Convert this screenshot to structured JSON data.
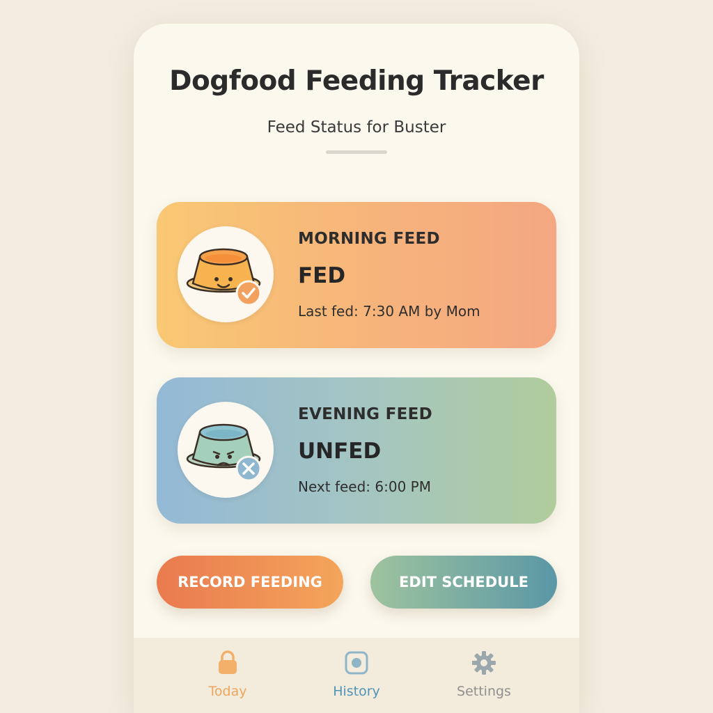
{
  "app": {
    "title": "Dogfood Feeding Tracker",
    "subtitle": "Feed Status for Buster"
  },
  "cards": [
    {
      "label": "MORNING FEED",
      "status": "FED",
      "detail": "Last fed: 7:30 AM by Mom",
      "icon": "happy-bowl-check-icon"
    },
    {
      "label": "EVENING FEED",
      "status": "UNFED",
      "detail": "Next feed: 6:00 PM",
      "icon": "sad-bowl-x-icon"
    }
  ],
  "actions": {
    "record_label": "RECORD FEEDING",
    "edit_label": "EDIT SCHEDULE"
  },
  "nav": {
    "items": [
      {
        "label": "Today",
        "icon": "lock-icon",
        "color": "#f0a860"
      },
      {
        "label": "History",
        "icon": "record-icon",
        "color": "#5f9fc0"
      },
      {
        "label": "Settings",
        "icon": "gear-icon",
        "color": "#8f8f8f"
      }
    ]
  },
  "colors": {
    "background": "#f3ecdf",
    "morning_gradient": [
      "#f9c874",
      "#f4a781"
    ],
    "evening_gradient": [
      "#94b9d6",
      "#b0cc9c"
    ],
    "record_button": [
      "#e97a4f",
      "#f4a55b"
    ],
    "edit_button": [
      "#9ec39e",
      "#5a97a6"
    ]
  }
}
